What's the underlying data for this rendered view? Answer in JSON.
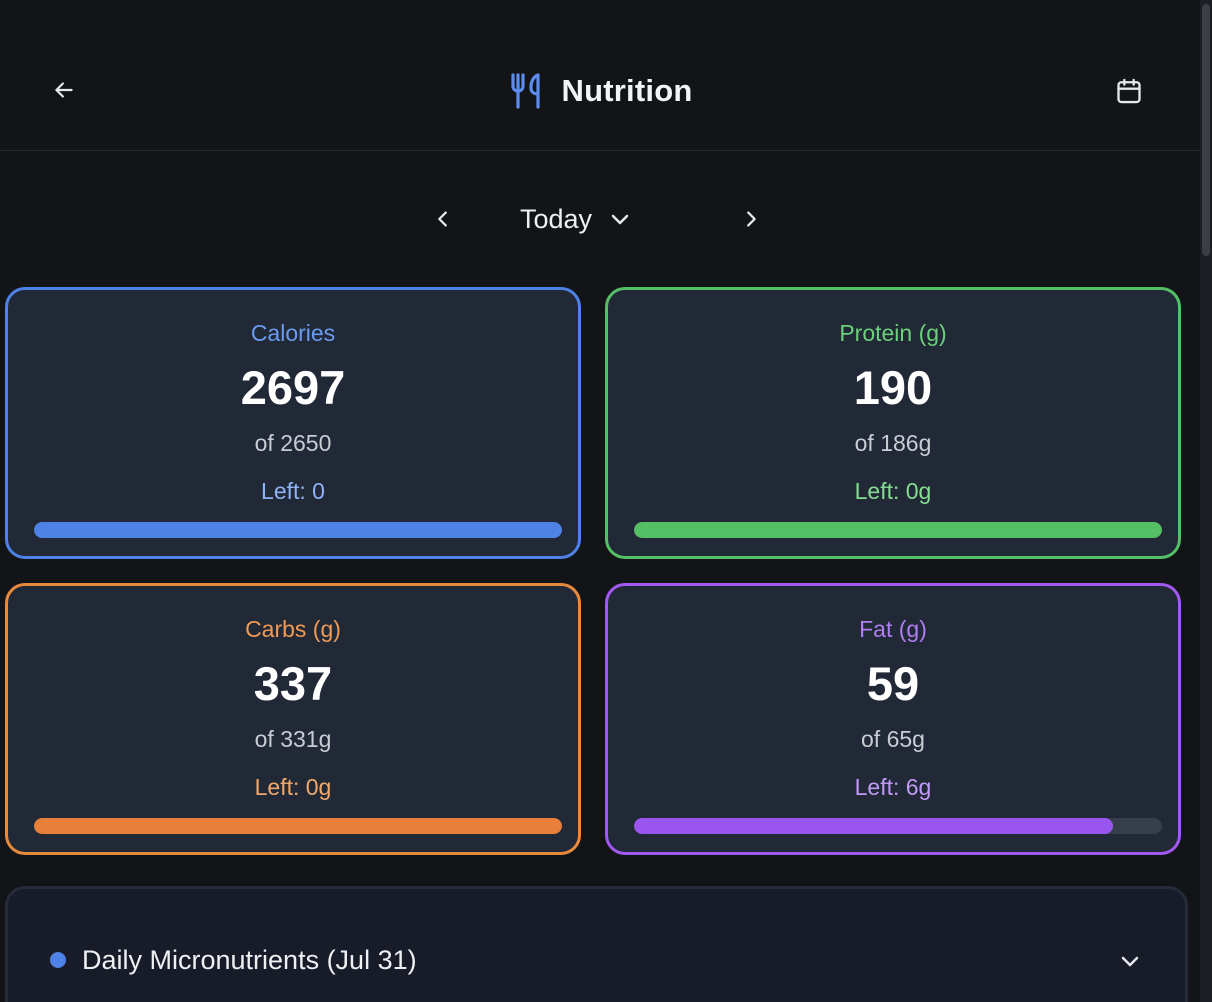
{
  "header": {
    "title": "Nutrition",
    "back_icon": "arrow-left-icon",
    "title_icon": "fork-knife-icon",
    "calendar_icon": "calendar-icon",
    "accent": "#5b8def"
  },
  "date_nav": {
    "label": "Today",
    "prev_icon": "chevron-left-icon",
    "next_icon": "chevron-right-icon",
    "dropdown_icon": "chevron-down-icon"
  },
  "cards": [
    {
      "key": "calories",
      "label": "Calories",
      "value": "2697",
      "goal": "of 2650",
      "left": "Left: 0",
      "progress": 1.0,
      "color": "#4f82e6",
      "label_color": "#6a9bf0",
      "left_color": "#8fb3f5"
    },
    {
      "key": "protein",
      "label": "Protein (g)",
      "value": "190",
      "goal": "of 186g",
      "left": "Left: 0g",
      "progress": 1.0,
      "color": "#55bf66",
      "label_color": "#6ccf7c",
      "left_color": "#86dc93"
    },
    {
      "key": "carbs",
      "label": "Carbs (g)",
      "value": "337",
      "goal": "of 331g",
      "left": "Left: 0g",
      "progress": 1.0,
      "color": "#e8803a",
      "label_color": "#ef9a55",
      "left_color": "#f0a96d"
    },
    {
      "key": "fat",
      "label": "Fat (g)",
      "value": "59",
      "goal": "of 65g",
      "left": "Left: 6g",
      "progress": 0.908,
      "color": "#9b55ef",
      "label_color": "#b07ef2",
      "left_color": "#c09af5"
    }
  ],
  "micronutrients": {
    "title": "Daily Micronutrients (Jul 31)",
    "dot_color": "#4f82e6",
    "toggle_icon": "chevron-down-icon"
  }
}
